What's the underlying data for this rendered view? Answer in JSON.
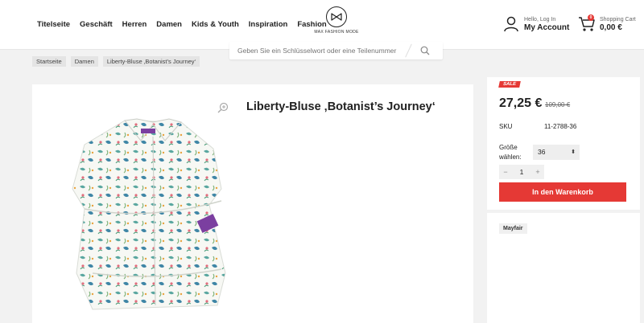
{
  "nav": {
    "items": [
      {
        "label": "Titelseite"
      },
      {
        "label": "Geschäft"
      },
      {
        "label": "Herren"
      },
      {
        "label": "Damen"
      },
      {
        "label": "Kids & Youth"
      },
      {
        "label": "Inspiration"
      },
      {
        "label": "Fashion"
      }
    ]
  },
  "logo": {
    "text": "MAX FASHION MODE"
  },
  "account": {
    "greeting": "Hello, Log In",
    "label": "My Account"
  },
  "cart": {
    "label": "Shopping Cart",
    "total": "0,00 €",
    "count": "0"
  },
  "search": {
    "placeholder": "Geben Sie ein Schlüsselwort oder eine Teilenummer"
  },
  "breadcrumb": [
    "Startseite",
    "Damen",
    "Liberty-Bluse ‚Botanist’s Journey‘"
  ],
  "product": {
    "title": "Liberty-Bluse ‚Botanist’s Journey‘",
    "sale_badge": "SALE",
    "price": "27,25 €",
    "old_price": "109,00 €",
    "sku_label": "SKU",
    "sku": "11-2788-36",
    "size_label": "Größe wählen:",
    "size_selected": "36",
    "quantity": "1",
    "qty_minus": "−",
    "qty_plus": "+",
    "add_to_cart": "In den Warenkorb",
    "brand": "Mayfair"
  },
  "colors": {
    "accent": "#e53935",
    "background": "#f2f2f2"
  }
}
